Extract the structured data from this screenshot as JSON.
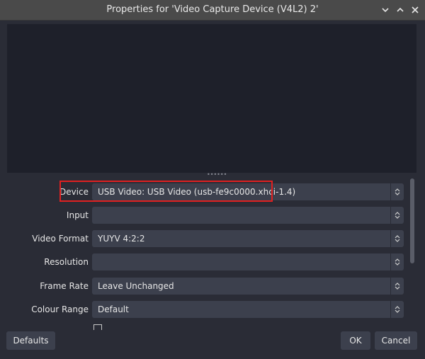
{
  "window": {
    "title": "Properties for 'Video Capture Device (V4L2) 2'",
    "controls": [
      "chevron-down-icon",
      "chevron-up-icon",
      "close-icon"
    ]
  },
  "properties": [
    {
      "label": "Device",
      "value": "USB Video: USB Video (usb-fe9c0000.xhci-1.4)",
      "highlighted": true
    },
    {
      "label": "Input",
      "value": ""
    },
    {
      "label": "Video Format",
      "value": "YUYV 4:2:2"
    },
    {
      "label": "Resolution",
      "value": ""
    },
    {
      "label": "Frame Rate",
      "value": "Leave Unchanged"
    },
    {
      "label": "Colour Range",
      "value": "Default"
    }
  ],
  "buttons": {
    "defaults": "Defaults",
    "ok": "OK",
    "cancel": "Cancel"
  },
  "colors": {
    "background": "#2a2c36",
    "combo": "#3c404d",
    "highlight": "#e02020"
  }
}
